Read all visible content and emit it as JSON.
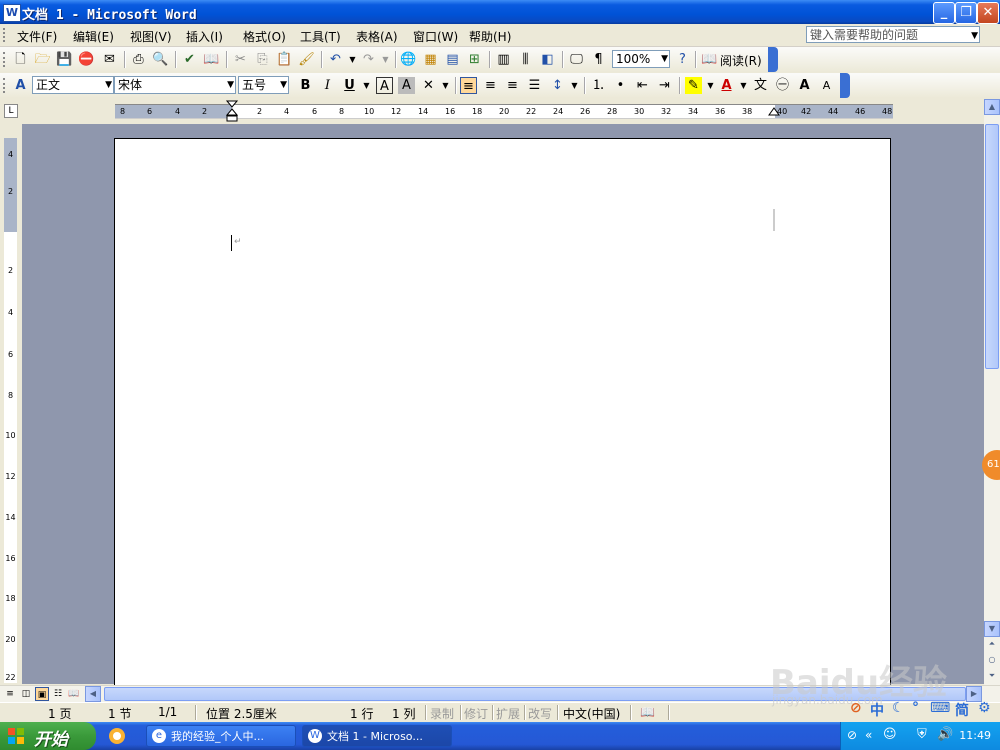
{
  "window": {
    "title": "文档 1 - Microsoft Word",
    "app_icon_letter": "W"
  },
  "menu": {
    "items": [
      "文件(F)",
      "编辑(E)",
      "视图(V)",
      "插入(I)",
      "格式(O)",
      "工具(T)",
      "表格(A)",
      "窗口(W)",
      "帮助(H)"
    ],
    "help_placeholder": "键入需要帮助的问题"
  },
  "toolbar_standard": {
    "zoom": "100%",
    "read_label": "阅读(R)"
  },
  "toolbar_format": {
    "style": "正文",
    "font": "宋体",
    "size": "五号",
    "bold": "B",
    "italic": "I",
    "underline": "U"
  },
  "ruler": {
    "left_labels": [
      "8",
      "6",
      "4",
      "2"
    ],
    "labels": [
      "2",
      "4",
      "6",
      "8",
      "10",
      "12",
      "14",
      "16",
      "18",
      "20",
      "22",
      "24",
      "26",
      "28",
      "30",
      "32",
      "34",
      "36",
      "38",
      "40",
      "42",
      "44",
      "46",
      "48"
    ],
    "vertical_labels": [
      "4",
      "2",
      "2",
      "4",
      "6",
      "8",
      "10",
      "12",
      "14",
      "16",
      "18",
      "20",
      "22"
    ]
  },
  "status": {
    "page": "1 页",
    "section": "1 节",
    "pages": "1/1",
    "position": "位置 2.5厘米",
    "line": "1 行",
    "column": "1 列",
    "rec": "录制",
    "trk": "修订",
    "ext": "扩展",
    "ovr": "改写",
    "language": "中文(中国)"
  },
  "taskbar": {
    "start": "开始",
    "tasks": [
      "我的经验_个人中...",
      "文档 1 - Microso..."
    ],
    "clock": "11:49",
    "ime": [
      "中",
      "简"
    ]
  },
  "float_badge": "61",
  "watermark": {
    "main": "Baidu经验",
    "sub": "jingyan.baidu.com"
  }
}
